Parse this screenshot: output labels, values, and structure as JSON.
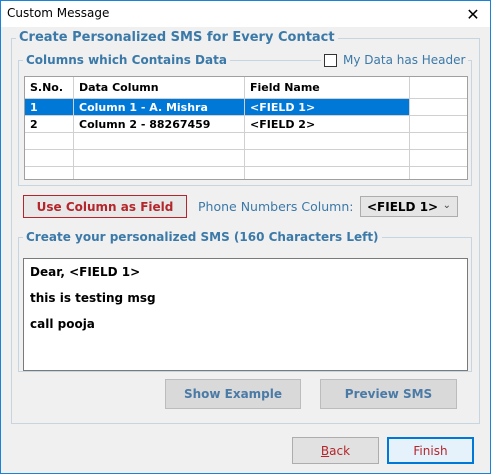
{
  "window": {
    "title": "Custom Message",
    "close_glyph": "✕"
  },
  "main_group": {
    "legend": "Create Personalized SMS for Every Contact"
  },
  "columns_group": {
    "legend": "Columns which Contains Data",
    "header_checkbox_label": "My Data has Header",
    "header_checkbox_checked": false
  },
  "grid": {
    "headers": [
      "S.No.",
      "Data Column",
      "Field Name"
    ],
    "rows": [
      {
        "sno": "1",
        "data_column": "Column 1 - A. Mishra",
        "field_name": "<FIELD 1>",
        "selected": true
      },
      {
        "sno": "2",
        "data_column": "Column 2 - 88267459",
        "field_name": "<FIELD 2>",
        "selected": false
      }
    ],
    "selected_color": "#0078d7"
  },
  "actions": {
    "use_column_label": "Use Column as Field",
    "phone_label": "Phone Numbers Column:",
    "phone_selected": "<FIELD 1>"
  },
  "sms_group": {
    "legend": "Create your personalized SMS (160 Characters Left)",
    "lines": [
      "Dear, <FIELD 1>",
      "this is testing msg",
      "call pooja"
    ]
  },
  "buttons": {
    "show_example": "Show Example",
    "preview_sms": "Preview SMS",
    "back_first": "B",
    "back_rest": "ack",
    "finish": "Finish"
  },
  "colors": {
    "accent": "#3b79a8",
    "danger": "#b3262b",
    "window_border": "#1883d7"
  }
}
